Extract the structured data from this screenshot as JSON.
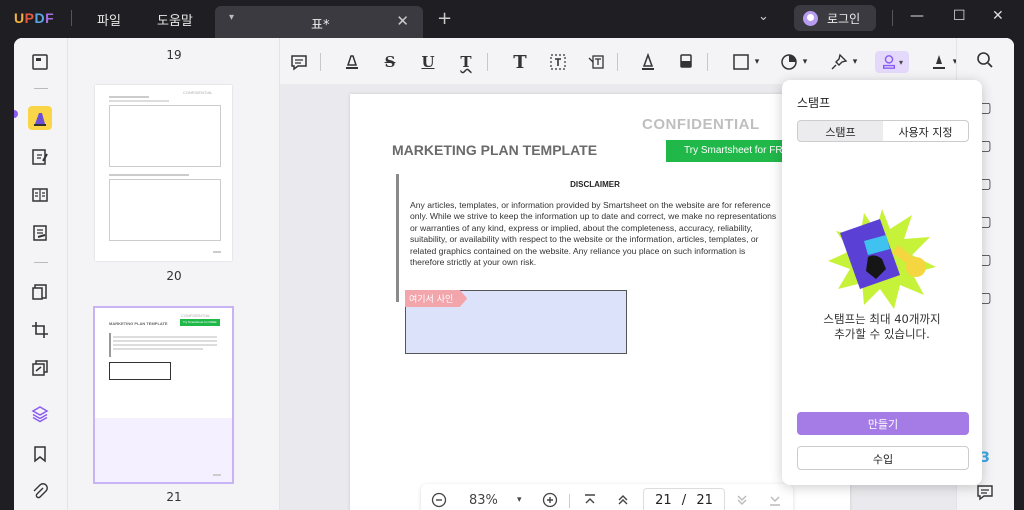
{
  "app": {
    "logo": "UPDF",
    "menu_file": "파일",
    "menu_help": "도움말",
    "tab_name": "표*",
    "login_label": "로그인"
  },
  "thumbnails": {
    "page_above_label": "19",
    "page_prev_label": "20",
    "page_current_label": "21",
    "thumb20_header": "CONFIDENTIAL",
    "thumb21_conf": "CONFIDENTIAL",
    "thumb21_title": "MARKETING PLAN TEMPLATE",
    "thumb21_try": "Try Smartsheet for FREE"
  },
  "document": {
    "confidential": "CONFIDENTIAL",
    "title": "MARKETING PLAN TEMPLATE",
    "try_button": "Try Smartsheet for FREE",
    "disclaimer_heading": "DISCLAIMER",
    "disclaimer_body": "Any articles, templates, or information provided by Smartsheet on the website are for reference only. While we strive to keep the information up to date and correct, we make no representations or warranties of any kind, express or implied, about the completeness, accuracy, reliability, suitability, or availability with respect to the website or the information, articles, templates, or related graphics contained on the website. Any reliance you place on such information is therefore strictly at your own risk.",
    "sign_tag": "여기서 사인"
  },
  "zoom": {
    "level": "83%",
    "current_page": "21",
    "separator": "/",
    "total_pages": "21"
  },
  "stamp_panel": {
    "title": "스탬프",
    "tab_stamp": "스탬프",
    "tab_custom": "사용자 지정",
    "message_line1": "스탬프는 최대 40개까지",
    "message_line2": "추가할 수 있습니다.",
    "create_button": "만들기",
    "import_button": "수입"
  },
  "colors": {
    "accent": "#a57be6",
    "highlight_yellow": "#f9d548",
    "green_button": "#21b84a",
    "sign_area": "#dde2fb",
    "sign_tag": "#f3a5ac"
  }
}
